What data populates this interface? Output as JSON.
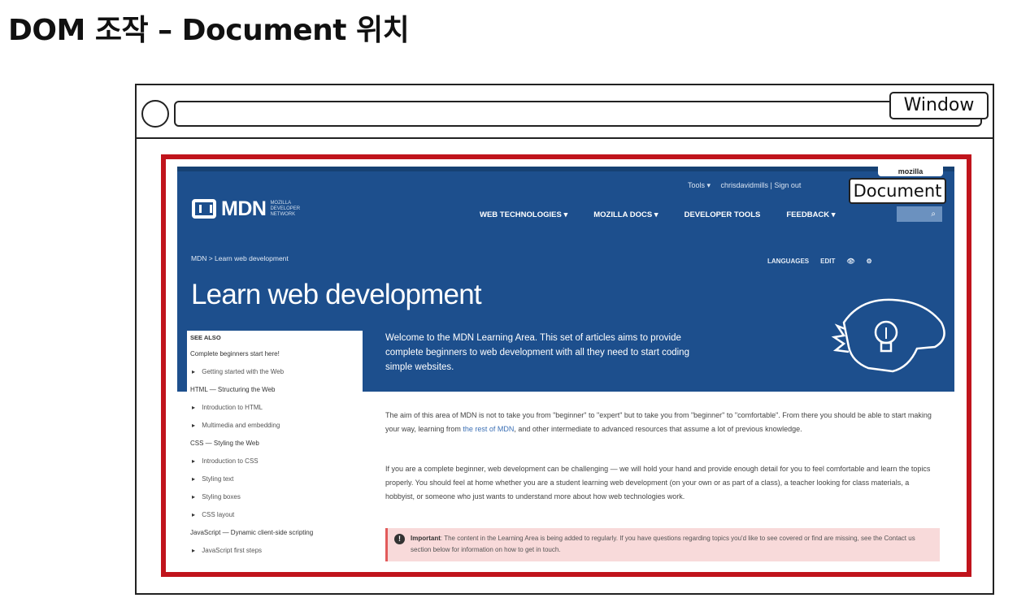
{
  "title": "DOM 조작 – Document 위치",
  "window": {
    "label": "Window"
  },
  "document": {
    "label": "Document"
  },
  "mdn": {
    "top_links": [
      "Tools ▾",
      "chrisdavidmills | Sign out"
    ],
    "mozilla_tab": "mozilla",
    "logo_text": "MDN",
    "logo_sub": "MOZILLA DEVELOPER NETWORK",
    "nav": [
      "WEB TECHNOLOGIES ▾",
      "MOZILLA DOCS ▾",
      "DEVELOPER TOOLS",
      "FEEDBACK ▾"
    ],
    "search_icon": "search-icon",
    "breadcrumb": "MDN > Learn web development",
    "actions": [
      "LANGUAGES",
      "EDIT",
      "👁",
      "⚙"
    ],
    "heading": "Learn web development",
    "intro": "Welcome to the MDN Learning Area. This set of articles aims to provide complete beginners to web development with all they need to start coding simple websites.",
    "sidebar": [
      {
        "text": "SEE ALSO",
        "kind": "head"
      },
      {
        "text": "Complete beginners start here!",
        "kind": "item"
      },
      {
        "text": "Getting started with the Web",
        "kind": "sub"
      },
      {
        "text": "HTML — Structuring the Web",
        "kind": "item"
      },
      {
        "text": "Introduction to HTML",
        "kind": "sub"
      },
      {
        "text": "Multimedia and embedding",
        "kind": "sub"
      },
      {
        "text": "CSS — Styling the Web",
        "kind": "item"
      },
      {
        "text": "Introduction to CSS",
        "kind": "sub"
      },
      {
        "text": "Styling text",
        "kind": "sub"
      },
      {
        "text": "Styling boxes",
        "kind": "sub"
      },
      {
        "text": "CSS layout",
        "kind": "sub"
      },
      {
        "text": "JavaScript — Dynamic client-side scripting",
        "kind": "item"
      },
      {
        "text": "JavaScript first steps",
        "kind": "sub"
      }
    ],
    "para1_a": "The aim of this area of MDN is not to take you from \"beginner\" to \"expert\" but to take you from \"beginner\" to \"comfortable\". From there you should be able to start making your way, learning from ",
    "para1_link": "the rest of MDN",
    "para1_b": ", and other intermediate to advanced resources that assume a lot of previous knowledge.",
    "para2": "If you are a complete beginner, web development can be challenging — we will hold your hand and provide enough detail for you to feel comfortable and learn the topics properly. You should feel at home whether you are a student learning web development (on your own or as part of a class), a teacher looking for class materials, a hobbyist, or someone who just wants to understand more about how web technologies work.",
    "warn_label": "Important",
    "warn_text": ": The content in the Learning Area is being added to regularly. If you have questions regarding topics you'd like to see covered or find are missing, see the Contact us section below for information on how to get in touch."
  }
}
